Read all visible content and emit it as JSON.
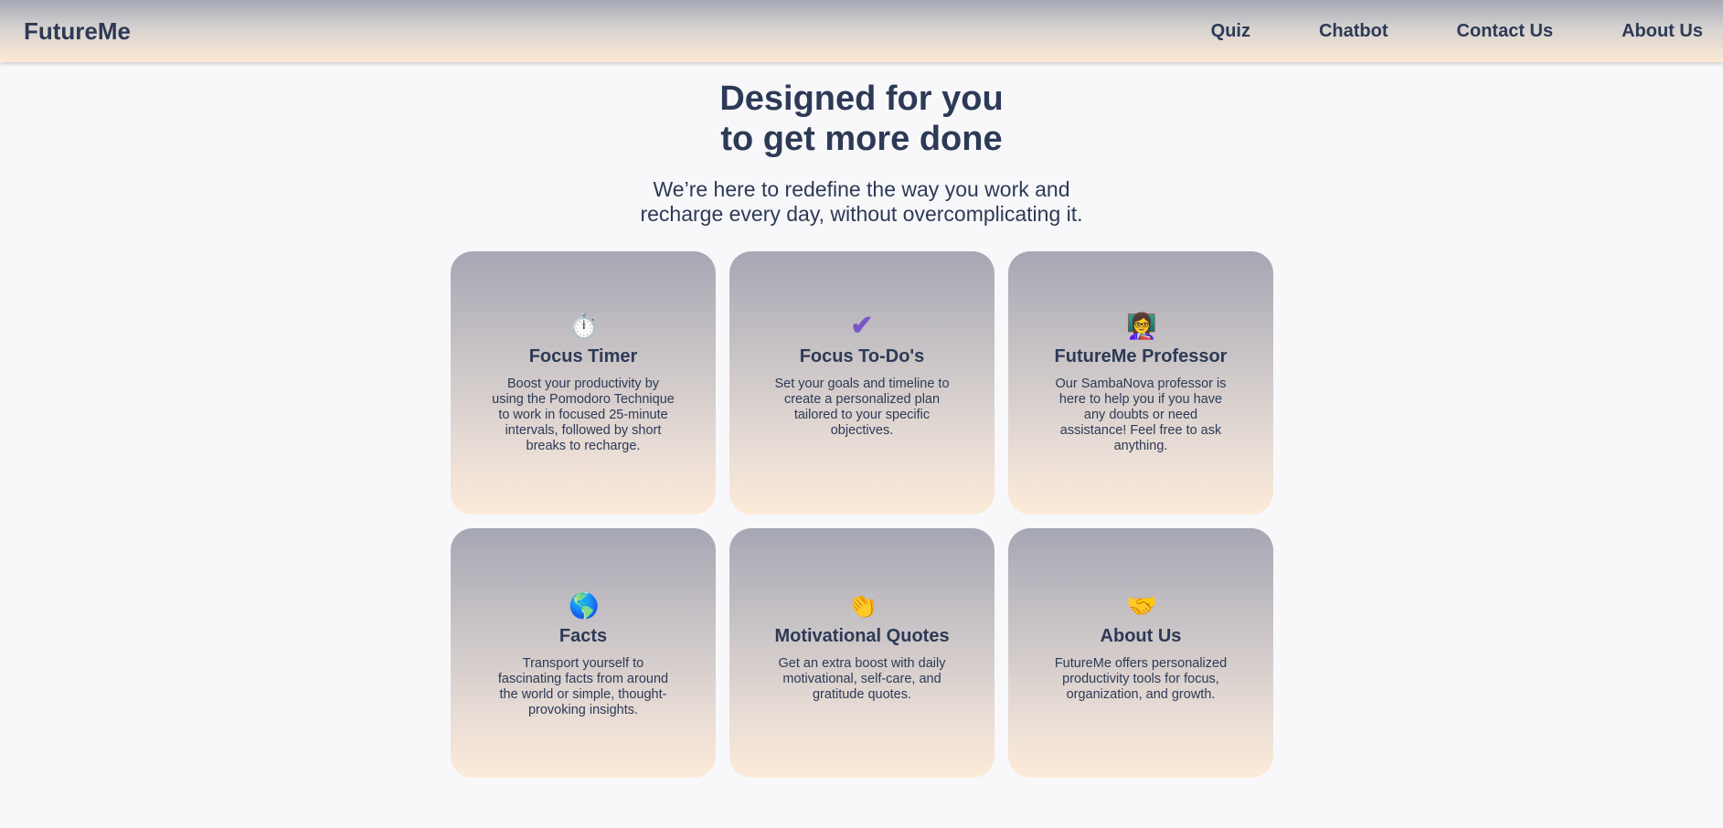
{
  "nav": {
    "brand": "FutureMe",
    "links": [
      "Quiz",
      "Chatbot",
      "Contact Us",
      "About Us"
    ]
  },
  "hero": {
    "title_line1": "Designed for you",
    "title_line2": "to get more done",
    "subtitle_line1": "We’re here to redefine the way you work and",
    "subtitle_line2": "recharge every day, without overcomplicating it."
  },
  "cards": [
    {
      "icon": "stopwatch-icon",
      "glyph": "⏱️",
      "title": "Focus Timer",
      "description": "Boost your productivity by using the Pomodoro Technique to work in focused 25-minute intervals, followed by short  breaks to recharge."
    },
    {
      "icon": "checkmark-icon",
      "glyph": "✔",
      "title": "Focus To-Do's",
      "description": "Set your goals and timeline to create a personalized plan tailored to your specific objectives."
    },
    {
      "icon": "professor-icon",
      "glyph": "👩‍🏫",
      "title": "FutureMe Professor",
      "description": "Our SambaNova professor is here to help you if you have any doubts or need assistance!   Feel free to ask anything."
    },
    {
      "icon": "globe-icon",
      "glyph": "🌎",
      "title": "Facts",
      "description": "Transport yourself to fascinating facts from around the world or simple, thought-provoking insights."
    },
    {
      "icon": "clapping-hands-icon",
      "glyph": "👏",
      "title": "Motivational Quotes",
      "description": "Get an extra boost with daily motivational, self-care, and gratitude quotes."
    },
    {
      "icon": "handshake-icon",
      "glyph": "🤝",
      "title": "About Us",
      "description": "FutureMe offers personalized productivity tools for focus, organization, and growth."
    }
  ],
  "colors": {
    "text": "#2d3a56",
    "background": "#f8f8fa",
    "gradient_top": "#a6a7b4",
    "gradient_bottom": "#fdebd9",
    "checkmark": "#7a55c8"
  }
}
